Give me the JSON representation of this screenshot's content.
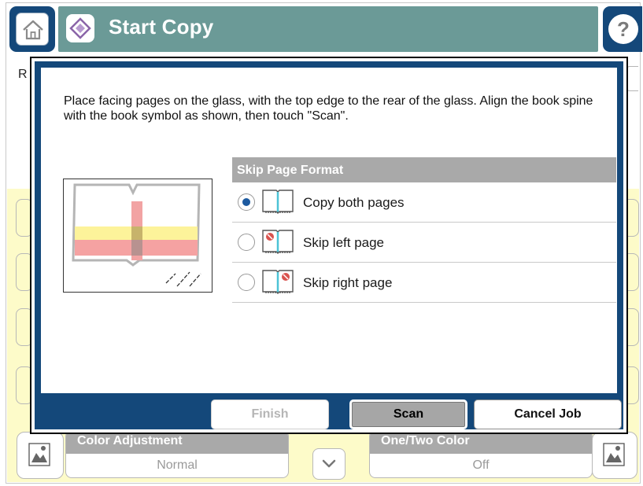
{
  "header": {
    "title": "Start Copy",
    "colors": {
      "header_bar": "#6b9a97",
      "button_blue": "#14487a"
    }
  },
  "background": {
    "left_fragment": "R",
    "color_adjustment": {
      "label": "Color Adjustment",
      "value": "Normal"
    },
    "one_two_color": {
      "label": "One/Two Color",
      "value": "Off"
    }
  },
  "dialog": {
    "instructions": "Place facing pages on the glass, with the top edge to the rear of the glass. Align the book spine with the book symbol as shown, then touch \"Scan\".",
    "format": {
      "header": "Skip Page Format",
      "options": [
        {
          "label": "Copy both pages",
          "selected": true,
          "icon": "book-both-pages-icon"
        },
        {
          "label": "Skip left page",
          "selected": false,
          "icon": "book-skip-left-icon"
        },
        {
          "label": "Skip right page",
          "selected": false,
          "icon": "book-skip-right-icon"
        }
      ]
    },
    "buttons": {
      "finish": "Finish",
      "scan": "Scan",
      "cancel": "Cancel Job"
    },
    "colors": {
      "frame": "#14487a",
      "selected_radio": "#1d5aa0",
      "panel_header": "#a9a9a9"
    }
  }
}
